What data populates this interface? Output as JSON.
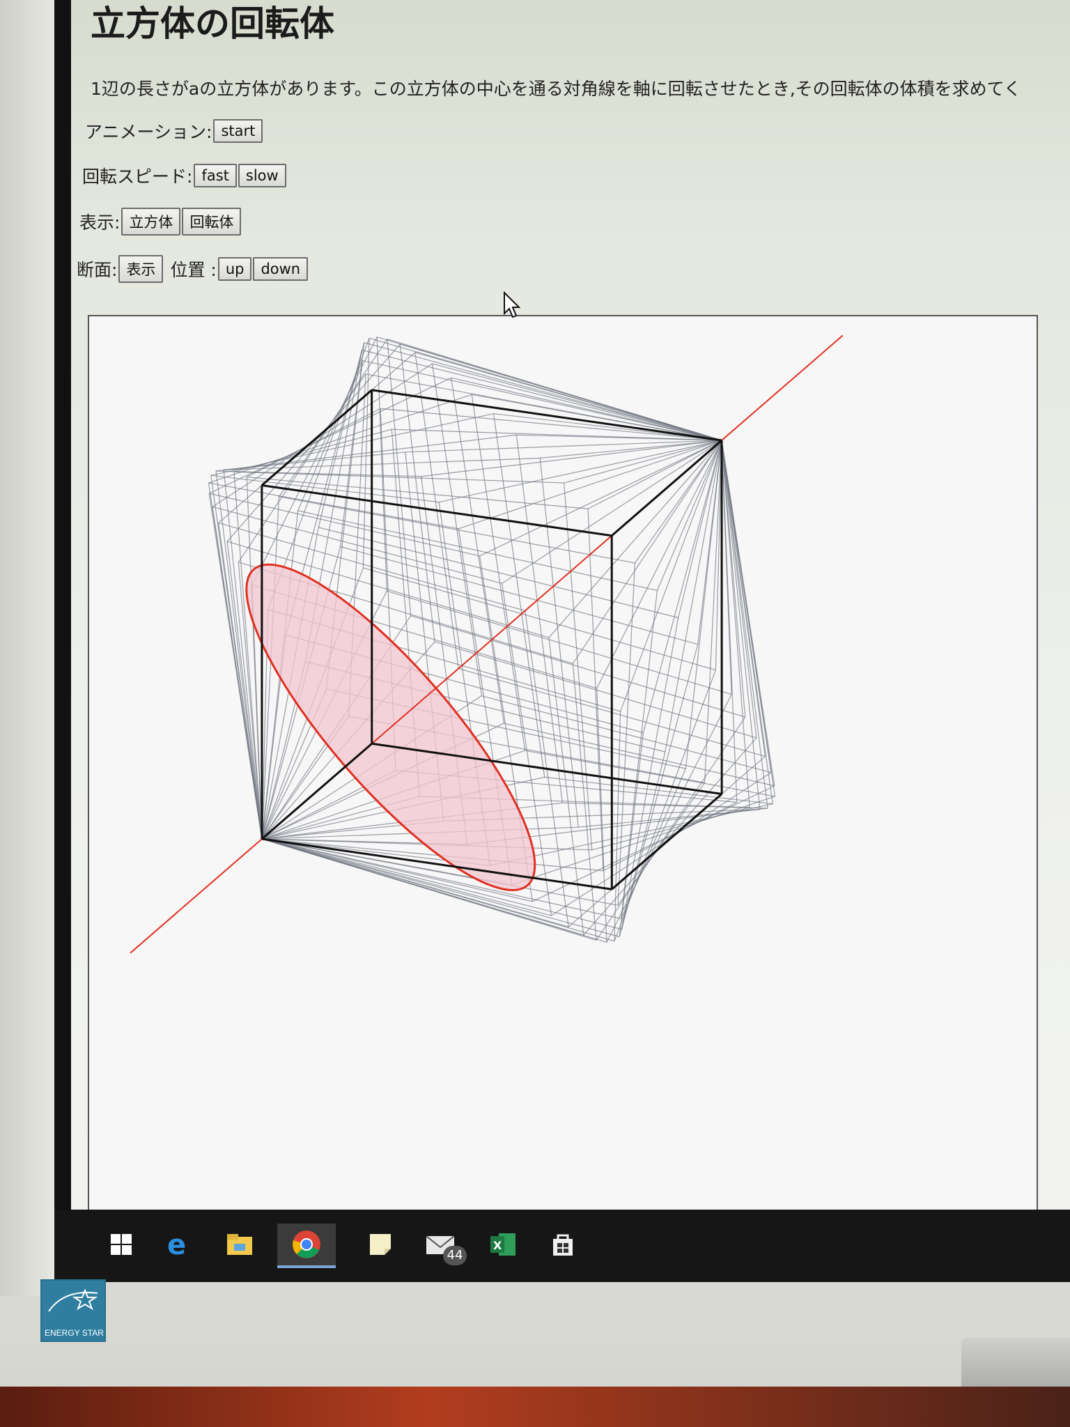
{
  "page": {
    "title": "立方体の回転体",
    "problem": "1辺の長さがaの立方体があります。この立方体の中心を通る対角線を軸に回転させたとき,その回転体の体積を求めてく"
  },
  "controls": {
    "animation": {
      "label": "アニメーション:",
      "start": "start"
    },
    "speed": {
      "label": "回転スピード:",
      "fast": "fast",
      "slow": "slow"
    },
    "view": {
      "label": "表示:",
      "cube": "立方体",
      "solid": "回転体"
    },
    "section": {
      "label": "断面:",
      "show": "表示",
      "position_label": "位置 :",
      "up": "up",
      "down": "down"
    }
  },
  "canvas": {
    "axis_color": "#e03020",
    "section_fill": "#f3c6d0",
    "cube_color": "#111111",
    "solid_color": "#6f7580"
  },
  "taskbar": {
    "icons": [
      "windows-start-icon",
      "edge-icon",
      "file-explorer-icon",
      "chrome-icon",
      "sticky-notes-icon",
      "mail-icon",
      "excel-icon",
      "store-icon"
    ],
    "mail_badge": "44",
    "active": "chrome-icon"
  },
  "monitor": {
    "label": "ENERGY STAR",
    "logo_script": "energy"
  }
}
